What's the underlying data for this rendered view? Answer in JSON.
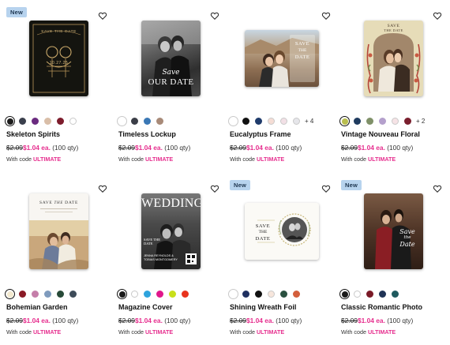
{
  "products": [
    {
      "name": "Skeleton Spirits",
      "badge": "New",
      "card_text": [
        "SAVE THE DATE",
        "10.27.25"
      ],
      "swatches": [
        "#1c1c1c",
        "#3a3f4c",
        "#6a2a7f",
        "#d9bea8",
        "#7d1c2c",
        "#ffffff"
      ],
      "more_colors": "",
      "old_price": "$2.09",
      "new_price": "$1.04 ea.",
      "qty": "(100 qty)",
      "code_prefix": "With code",
      "code": "ULTIMATE"
    },
    {
      "name": "Timeless Lockup",
      "badge": "",
      "card_text": [
        "Save",
        "OUR DATE"
      ],
      "swatches": [
        "#ffffff",
        "#3b3e47",
        "#3a78b5",
        "#a88a78"
      ],
      "more_colors": "",
      "old_price": "$2.09",
      "new_price": "$1.04 ea.",
      "qty": "(100 qty)",
      "code_prefix": "With code",
      "code": "ULTIMATE"
    },
    {
      "name": "Eucalyptus Frame",
      "badge": "",
      "card_text": [
        "SAVE",
        "THE",
        "DATE"
      ],
      "swatches": [
        "#ffffff",
        "#111111",
        "#1f3b6b",
        "#f5ddd5",
        "#f2e0e6",
        "#e6e6ea"
      ],
      "more_colors": "+ 4",
      "old_price": "$2.09",
      "new_price": "$1.04 ea.",
      "qty": "(100 qty)",
      "code_prefix": "With code",
      "code": "ULTIMATE"
    },
    {
      "name": "Vintage Nouveau Floral",
      "badge": "",
      "card_text": [
        "SAVE",
        "THE DATE"
      ],
      "swatches": [
        "#b9be4e",
        "#1f3b5f",
        "#7f9068",
        "#b4a0cc",
        "#f6e3e6",
        "#7a1f2e"
      ],
      "more_colors": "+ 2",
      "old_price": "$2.09",
      "new_price": "$1.04 ea.",
      "qty": "(100 qty)",
      "code_prefix": "With code",
      "code": "ULTIMATE"
    },
    {
      "name": "Bohemian Garden",
      "badge": "",
      "card_text": [
        "SAVE",
        "THE",
        "DATE"
      ],
      "swatches": [
        "#f3e9cf",
        "#8a1a26",
        "#c57ea9",
        "#7f9bbd",
        "#274a38",
        "#3d4b59"
      ],
      "more_colors": "",
      "old_price": "$2.09",
      "new_price": "$1.04 ea.",
      "qty": "(100 qty)",
      "code_prefix": "With code",
      "code": "ULTIMATE"
    },
    {
      "name": "Magazine Cover",
      "badge": "",
      "card_text": [
        "WEDDING",
        "SAVE THE DATE",
        "JENNA REYNOLDS & TOBIAS MONTGOMERY"
      ],
      "swatches": [
        "#1a1a1a",
        "#ffffff",
        "#2ea3dd",
        "#e0178c",
        "#c8df1a",
        "#e8331d"
      ],
      "more_colors": "",
      "old_price": "$2.09",
      "new_price": "$1.04 ea.",
      "qty": "(100 qty)",
      "code_prefix": "With code",
      "code": "ULTIMATE"
    },
    {
      "name": "Shining Wreath Foil",
      "badge": "New",
      "card_text": [
        "SAVE",
        "THE",
        "DATE"
      ],
      "swatches": [
        "#ffffff",
        "#1f3060",
        "#111111",
        "#f7e6dc",
        "#2a5040",
        "#d35f3c"
      ],
      "more_colors": "",
      "old_price": "$2.09",
      "new_price": "$1.04 ea.",
      "qty": "(100 qty)",
      "code_prefix": "With code",
      "code": "ULTIMATE"
    },
    {
      "name": "Classic Romantic Photo",
      "badge": "New",
      "card_text": [
        "Save",
        "the",
        "Date"
      ],
      "swatches": [
        "#1a1a1a",
        "#ffffff",
        "#7a1a27",
        "#1f3355",
        "#1f5a5f"
      ],
      "more_colors": "",
      "old_price": "$2.09",
      "new_price": "$1.04 ea.",
      "qty": "(100 qty)",
      "code_prefix": "With code",
      "code": "ULTIMATE"
    }
  ],
  "icons": {
    "favorite": "heart-outline-icon"
  },
  "colors": {
    "sale": "#e62e8e",
    "badge_bg": "#b7d3ee"
  }
}
